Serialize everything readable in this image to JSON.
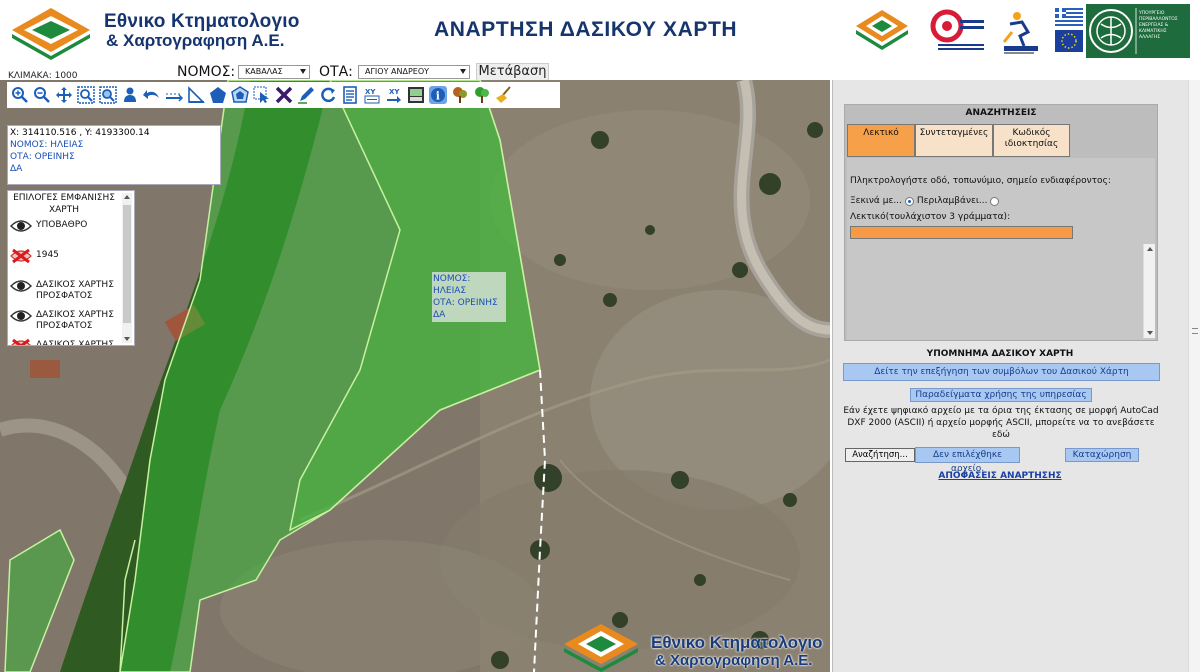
{
  "header": {
    "logo_line1": "Εθνικο Κτηματολογιο",
    "logo_line2": "& Χαρτογραφηση Α.Ε.",
    "title": "ΑΝΑΡΤΗΣΗ ΔΑΣΙΚΟΥ ΧΑΡΤΗ",
    "partner_ministry_text": "ΥΠΟΥΡΓΕΙΟ ΠΕΡΙΒΑΛΛΟΝΤΟΣ ΕΝΕΡΓΕΙΑΣ & ΚΛΙΜΑΤΙΚΗΣ ΑΛΛΑΓΗΣ"
  },
  "toolbar": {
    "scale_label": "ΚΛΙΜΑΚΑ: 1000",
    "nomos_label": "ΝΟΜΟΣ:",
    "nomos_value": "ΚΑΒΑΛΑΣ",
    "ota_label": "ΟΤΑ:",
    "ota_value": "ΑΓΙΟΥ ΑΝΔΡΕΟΥ",
    "go_label": "Μετάβαση"
  },
  "map_tools": [
    "zoom-in-icon",
    "zoom-out-icon",
    "pan-icon",
    "zoom-box-icon",
    "zoom-extent-icon",
    "identify-person-icon",
    "back-icon",
    "measure-line-icon",
    "measure-tool-icon",
    "polygon-icon",
    "star-shape-icon",
    "select-arrow-icon",
    "clear-x-icon",
    "pencil-icon",
    "refresh-icon",
    "report-icon",
    "xy-goto-icon",
    "xy-export-icon",
    "print-icon",
    "info-icon",
    "tree-brown-icon",
    "tree-green-icon",
    "broom-icon"
  ],
  "coords": {
    "xy": "X: 314110.516 , Y: 4193300.14",
    "nomos": "ΝΟΜΟΣ: ΗΛΕΙΑΣ",
    "ota": "ΟΤΑ: ΟΡΕΙΝΗΣ",
    "extra": "ΔΑ"
  },
  "layers": {
    "title": "ΕΠΙΛΟΓΕΣ ΕΜΦΑΝΙΣΗΣ ΧΑΡΤΗ",
    "items": [
      {
        "label": "ΥΠΟΒΑΘΡΟ",
        "icon": "eye-icon"
      },
      {
        "label": "1945",
        "icon": "hidden-x-icon"
      },
      {
        "label": "ΔΑΣΙΚΟΣ ΧΑΡΤΗΣ ΠΡΟΣΦΑΤΟΣ",
        "icon": "eye-icon"
      },
      {
        "label": "ΔΑΣΙΚΟΣ ΧΑΡΤΗΣ ΠΡΟΣΦΑΤΟΣ",
        "icon": "eye-icon"
      },
      {
        "label": "ΔΑΣΙΚΟΣ ΧΑΡΤΗΣ",
        "icon": "hidden-x-icon"
      }
    ]
  },
  "map_label": {
    "line1": "ΝΟΜΟΣ: ΗΛΕΙΑΣ",
    "line2": "ΟΤΑ: ΟΡΕΙΝΗΣ",
    "line3": "ΔΑ"
  },
  "watermark": {
    "line1": "Εθνικο Κτηματολογιο",
    "line2": "& Χαρτογραφηση Α.Ε."
  },
  "search": {
    "title": "ΑΝΑΖΗΤΗΣΕΙΣ",
    "tabs": [
      "Λεκτικό",
      "Συντεταγμένες",
      "Κωδικός ιδιοκτησίας"
    ],
    "prompt": "Πληκτρολογήστε οδό, τοπωνύμιο, σημείο ενδιαφέροντος:",
    "radio_starts": "Ξεκινά με...",
    "radio_contains": "Περιλαμβάνει...",
    "word_label": "Λεκτικό(τουλάχιστον 3 γράμματα):",
    "word_value": ""
  },
  "legend": {
    "title": "ΥΠΟΜΝΗΜΑ ΔΑΣΙΚΟΥ ΧΑΡΤΗ",
    "button": "Δείτε την επεξήγηση των συμβόλων του Δασικού Χάρτη",
    "examples": "Παραδείγματα χρήσης της υπηρεσίας",
    "upload_text": "Εάν έχετε ψηφιακό αρχείο με τα όρια της έκτασης σε μορφή AutoCad DXF 2000 (ASCII) ή αρχείο μορφής ASCII, μπορείτε να το ανεβάσετε εδώ",
    "browse": "Αναζήτηση...",
    "file_status": "Δεν επιλέχθηκε αρχείο.",
    "register": "Καταχώρηση",
    "decisions": "ΑΠΟΦΑΣΕΙΣ ΑΝΑΡΤΗΣΗΣ"
  },
  "colors": {
    "brand_blue": "#16356e",
    "tab_active": "#f7a04a",
    "input_orange": "#f79a48",
    "button_blue": "#a9c8f1",
    "forest_overlay": "#2fa82f"
  }
}
